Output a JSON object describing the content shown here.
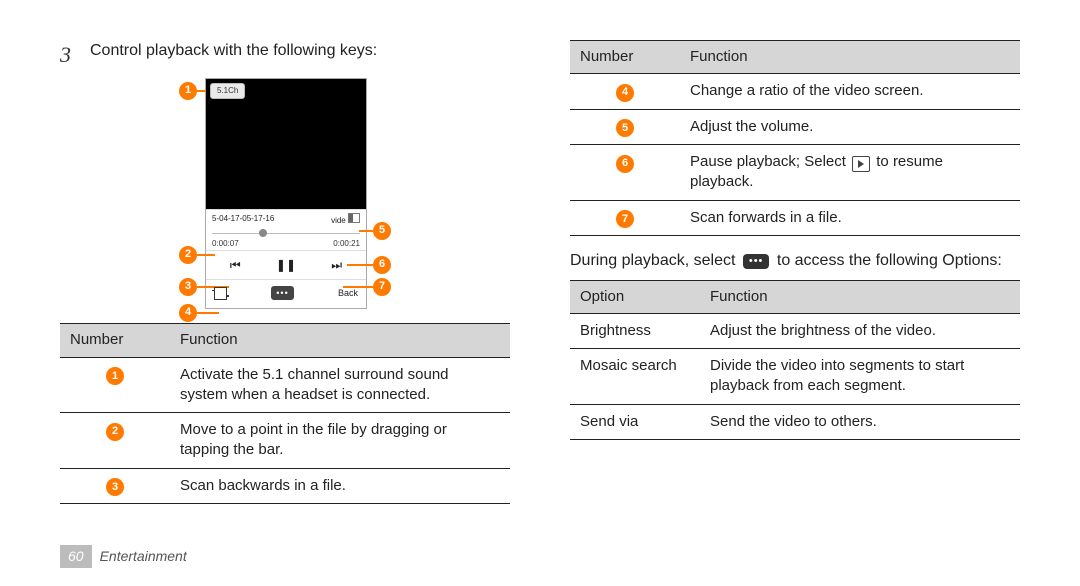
{
  "step": {
    "number": "3",
    "text": "Control playback with the following keys:"
  },
  "phone": {
    "chip": "5.1Ch",
    "filename": "5-04-17-05-17-16",
    "label_vid": "vide",
    "time_elapsed": "0:00:07",
    "time_total": "0:00:21",
    "back": "Back"
  },
  "callouts": [
    "1",
    "2",
    "3",
    "4",
    "5",
    "6",
    "7"
  ],
  "t1": {
    "h1": "Number",
    "h2": "Function",
    "rows": [
      {
        "n": "1",
        "f": "Activate the 5.1 channel surround sound system when a headset is connected."
      },
      {
        "n": "2",
        "f": "Move to a point in the file by dragging or tapping the bar."
      },
      {
        "n": "3",
        "f": "Scan backwards in a file."
      }
    ]
  },
  "t2": {
    "h1": "Number",
    "h2": "Function",
    "rows": [
      {
        "n": "4",
        "f": "Change a ratio of the video screen."
      },
      {
        "n": "5",
        "f": "Adjust the volume."
      },
      {
        "n": "6",
        "f_pre": "Pause playback; Select ",
        "f_post": " to resume playback."
      },
      {
        "n": "7",
        "f": "Scan forwards in a file."
      }
    ]
  },
  "para": {
    "pre": "During playback, select ",
    "post": " to access the following Options:"
  },
  "t3": {
    "h1": "Option",
    "h2": "Function",
    "rows": [
      {
        "o": "Brightness",
        "f": "Adjust the brightness of the video."
      },
      {
        "o": "Mosaic search",
        "f": "Divide the video into segments to start playback from each segment."
      },
      {
        "o": "Send via",
        "f": "Send the video to others."
      }
    ]
  },
  "footer": {
    "page": "60",
    "section": "Entertainment"
  }
}
